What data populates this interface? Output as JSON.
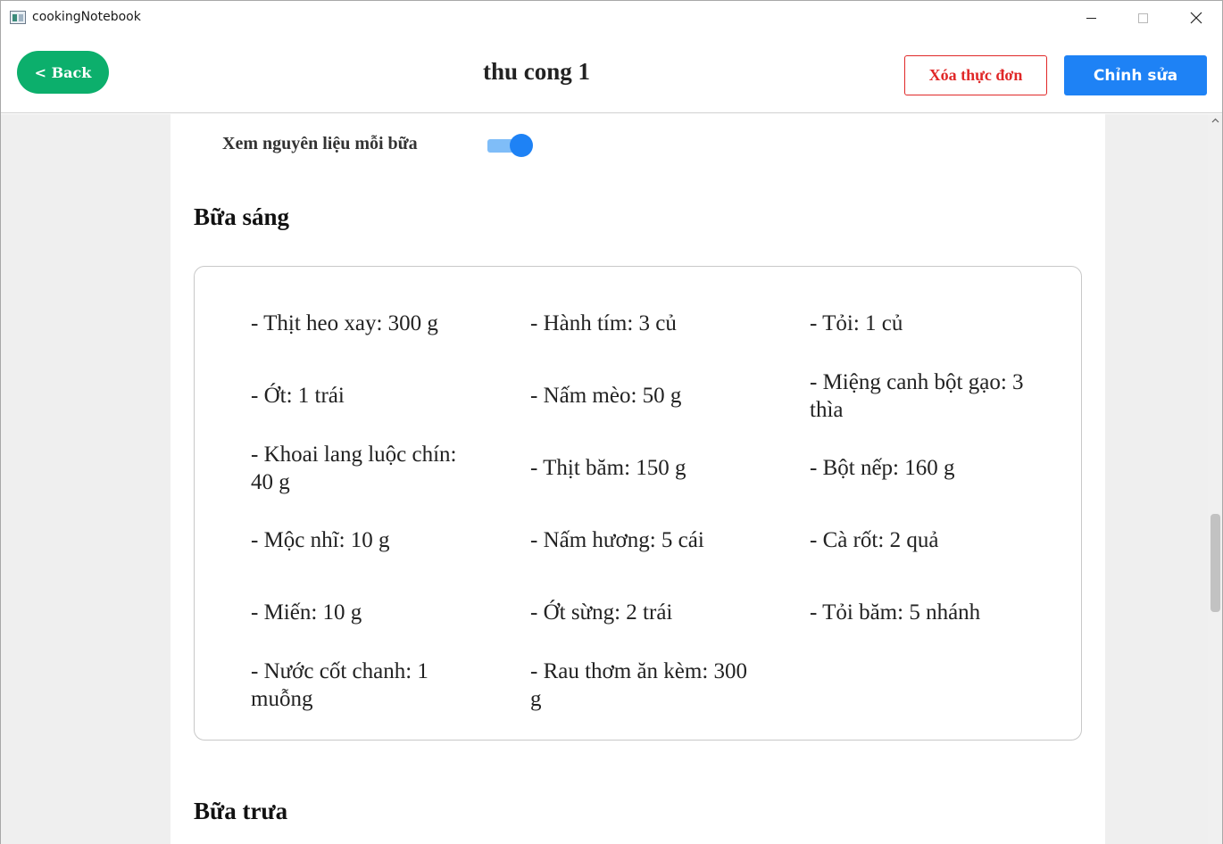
{
  "window": {
    "title": "cookingNotebook",
    "app_icon": "app-icon",
    "controls": [
      "minimize-icon",
      "maximize-icon",
      "close-icon"
    ]
  },
  "header": {
    "back_label": "< Back",
    "title": "thu cong 1",
    "delete_label": "Xóa thực đơn",
    "edit_label": "Chỉnh sửa",
    "colors": {
      "back": "#0caf6c",
      "delete": "#e02828",
      "edit": "#1e82f5"
    }
  },
  "toggle": {
    "label": "Xem nguyên liệu mỗi bữa",
    "on": true
  },
  "meals": [
    {
      "title": "Bữa sáng",
      "ingredients": [
        "- Thịt heo xay: 300 g",
        "- Hành tím: 3 củ",
        "- Tỏi: 1 củ",
        "- Ớt: 1 trái",
        "- Nấm mèo: 50 g",
        "- Miệng canh bột gạo: 3 thìa",
        "- Khoai lang luộc chín: 40 g",
        "- Thịt băm: 150 g",
        "- Bột nếp: 160 g",
        "- Mộc nhĩ: 10 g",
        "- Nấm hương: 5 cái",
        "- Cà rốt: 2 quả",
        "- Miến: 10 g",
        "- Ớt sừng: 2 trái",
        "- Tỏi băm: 5 nhánh",
        "- Nước cốt chanh: 1 muỗng",
        "- Rau thơm ăn kèm: 300 g"
      ]
    },
    {
      "title": "Bữa trưa"
    }
  ]
}
